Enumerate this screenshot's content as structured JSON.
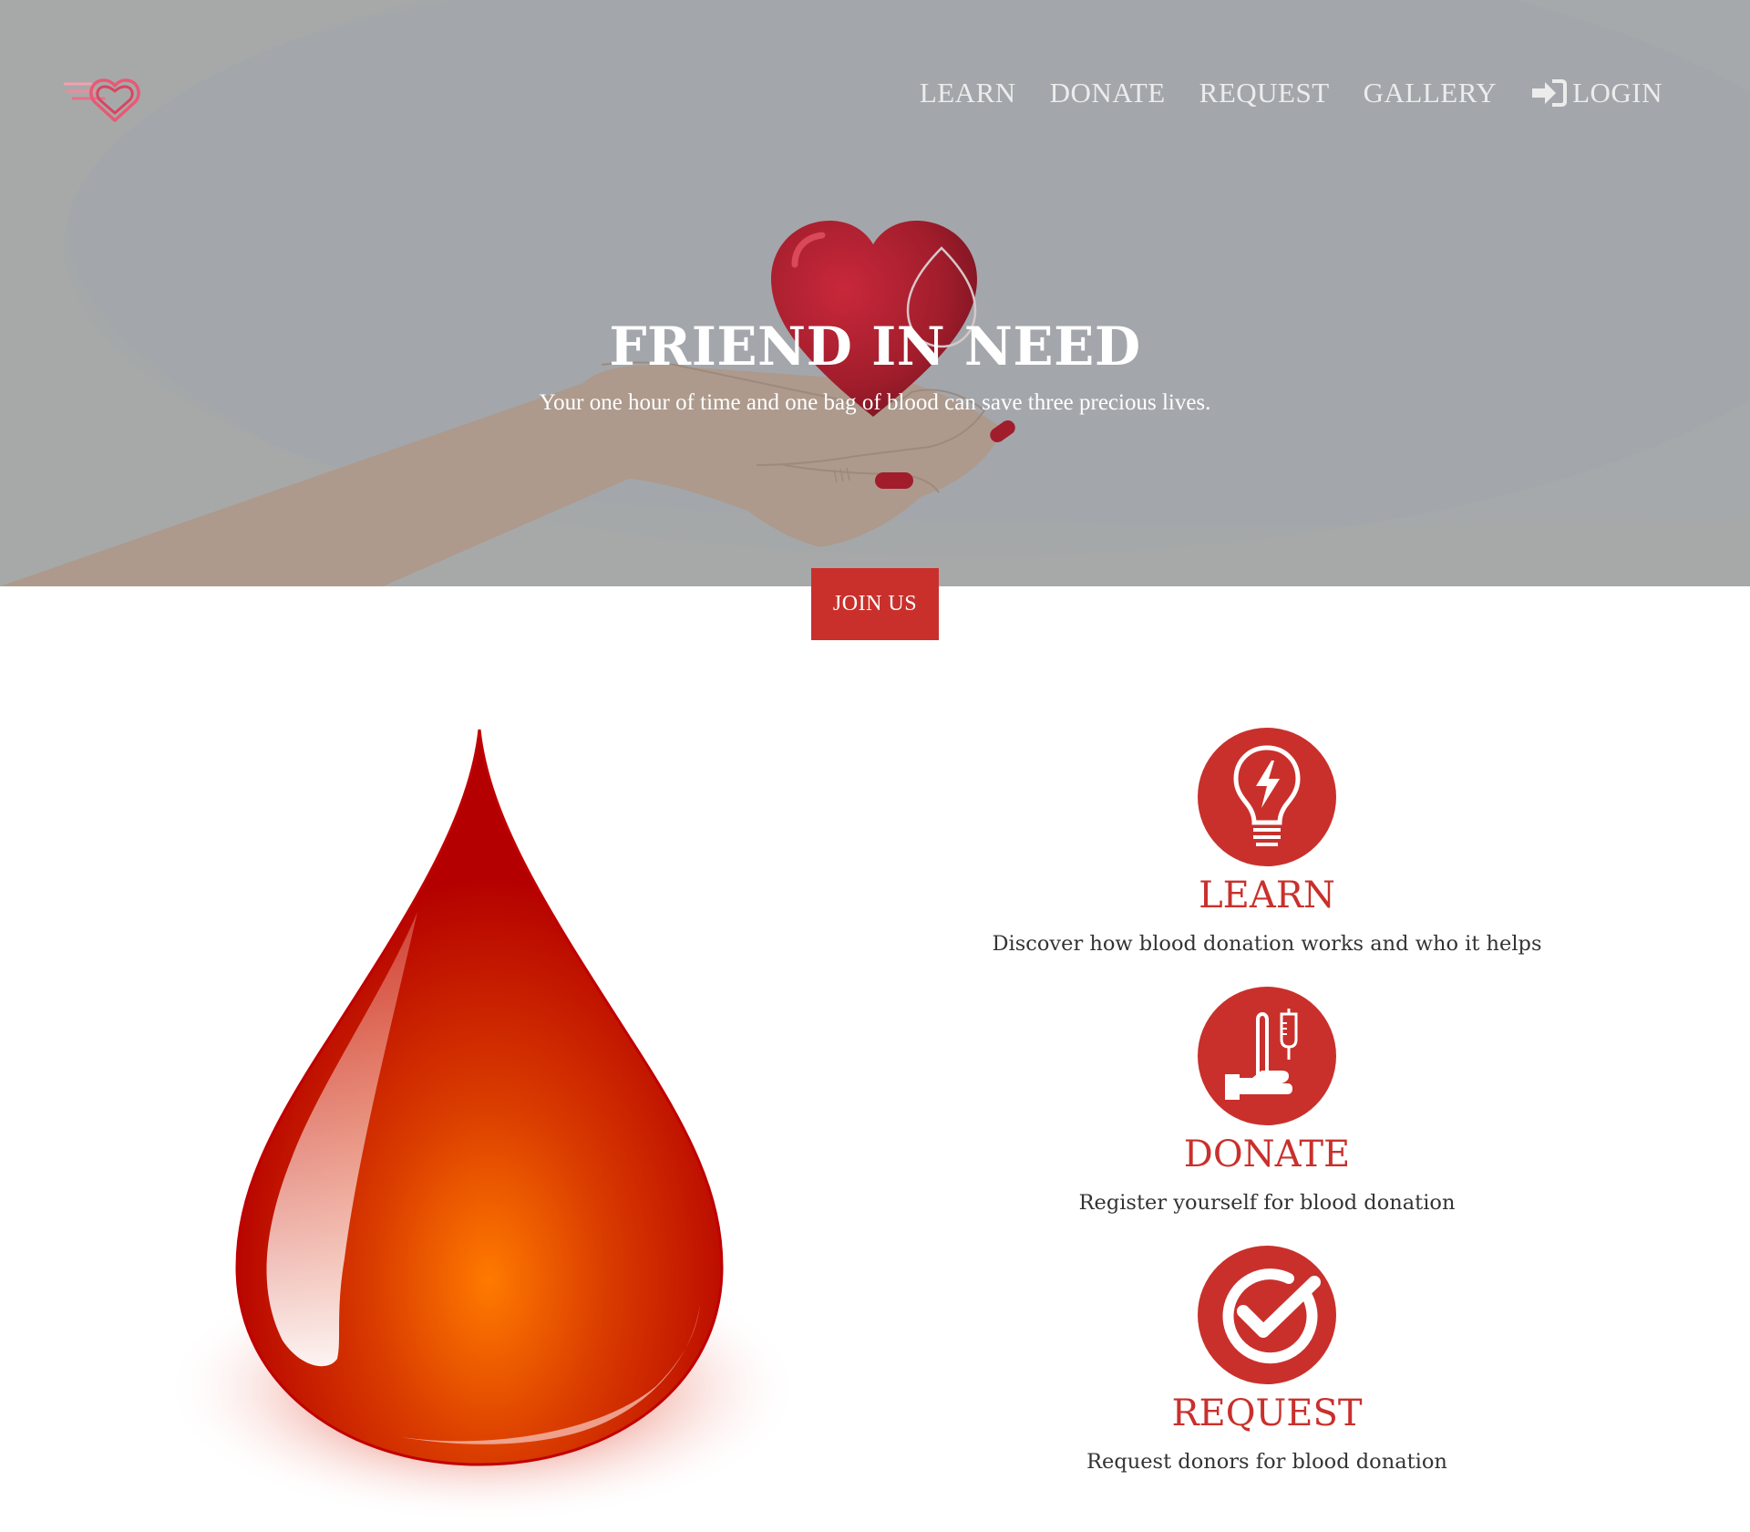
{
  "colors": {
    "hero_background": "#a6a9ab",
    "accent": "#c9302c",
    "nav_text": "#ececec",
    "body_text": "#333333"
  },
  "logo": {
    "icon": "heart-logo-icon"
  },
  "nav": {
    "items": [
      {
        "label": "LEARN"
      },
      {
        "label": "DONATE"
      },
      {
        "label": "REQUEST"
      },
      {
        "label": "GALLERY"
      }
    ],
    "login": {
      "label": "LOGIN",
      "icon": "login-icon"
    }
  },
  "hero": {
    "title": "FRIEND IN NEED",
    "subtitle": "Your one hour of time and one bag of blood can save three precious lives.",
    "cta_label": "JOIN US"
  },
  "features": [
    {
      "icon": "lightbulb-icon",
      "title": "LEARN",
      "description": "Discover how blood donation works and who it helps"
    },
    {
      "icon": "donation-icon",
      "title": "DONATE",
      "description": "Register yourself for blood donation"
    },
    {
      "icon": "checkmark-icon",
      "title": "REQUEST",
      "description": "Request donors for blood donation"
    }
  ]
}
